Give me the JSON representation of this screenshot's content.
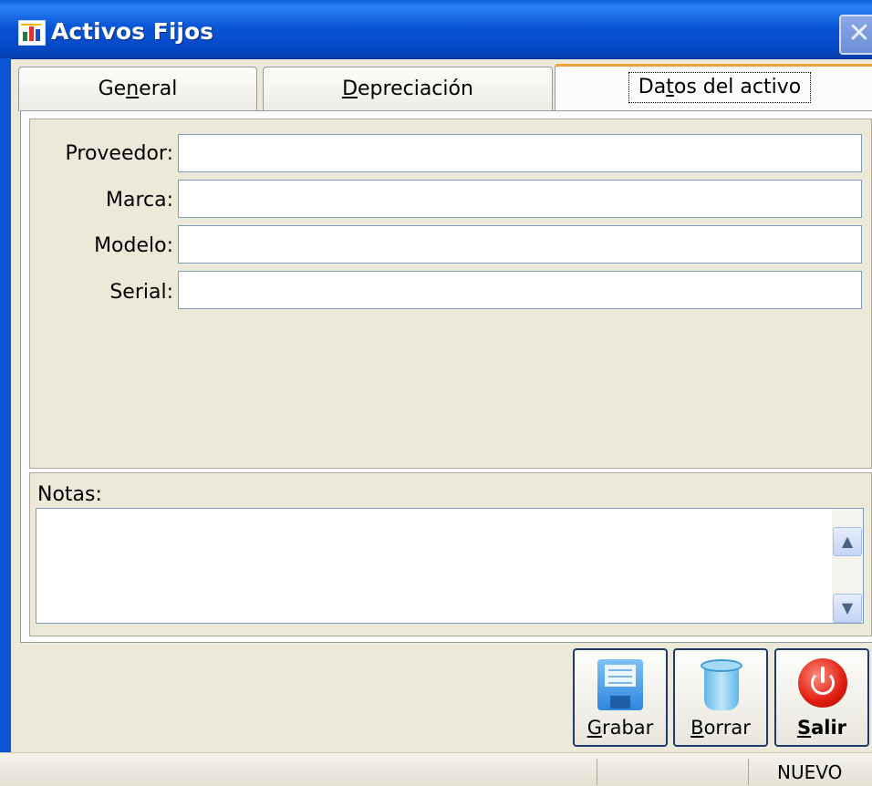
{
  "window": {
    "title": "Activos Fijos",
    "close_glyph": "✕"
  },
  "tabs": [
    {
      "pre": "Ge",
      "key": "n",
      "post": "eral"
    },
    {
      "pre": "",
      "key": "D",
      "post": "epreciación"
    },
    {
      "pre": "Da",
      "key": "t",
      "post": "os del activo"
    }
  ],
  "form": {
    "fields": [
      {
        "label": "Proveedor:",
        "value": ""
      },
      {
        "label": "Marca:",
        "value": ""
      },
      {
        "label": "Modelo:",
        "value": ""
      },
      {
        "label": "Serial:",
        "value": ""
      }
    ],
    "notes_label": "Notas:",
    "notes_value": ""
  },
  "scroll": {
    "up": "▲",
    "down": "▼"
  },
  "buttons": [
    {
      "key": "G",
      "post": "rabar",
      "icon": "floppy-disk-icon"
    },
    {
      "key": "B",
      "post": "orrar",
      "icon": "trash-bin-icon"
    },
    {
      "key": "S",
      "post": "alir",
      "icon": "power-icon"
    }
  ],
  "status": {
    "mode": "NUEVO"
  }
}
